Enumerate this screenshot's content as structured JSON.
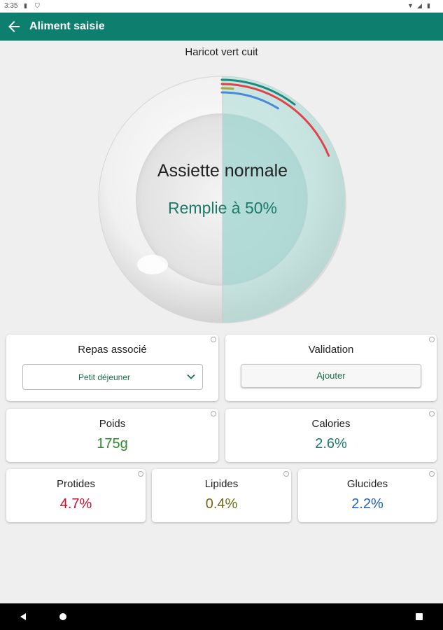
{
  "status_bar": {
    "time": "3:35",
    "icons": [
      "sim-icon",
      "shield-icon",
      "wifi-icon",
      "signal-icon",
      "battery-icon"
    ]
  },
  "app_bar": {
    "title": "Aliment saisie",
    "back_icon": "arrow-left-icon"
  },
  "food": {
    "name": "Haricot vert cuit"
  },
  "plate": {
    "title": "Assiette normale",
    "fill_text": "Remplie à 50%",
    "fill_fraction": 0.5,
    "rings": [
      {
        "name": "calories",
        "color": "#1a8a7a",
        "fraction": 0.026
      },
      {
        "name": "protides",
        "color": "#e0434a",
        "fraction": 0.047
      },
      {
        "name": "lipides",
        "color": "#a8a930",
        "fraction": 0.004
      },
      {
        "name": "glucides",
        "color": "#4a89d9",
        "fraction": 0.022
      }
    ]
  },
  "meal": {
    "label": "Repas associé",
    "selected": "Petit déjeuner"
  },
  "validation": {
    "label": "Validation",
    "button": "Ajouter"
  },
  "weight": {
    "label": "Poids",
    "value": "175g"
  },
  "calories": {
    "label": "Calories",
    "value": "2.6%"
  },
  "protides": {
    "label": "Protides",
    "value": "4.7%"
  },
  "lipides": {
    "label": "Lipides",
    "value": "0.4%"
  },
  "glucides": {
    "label": "Glucides",
    "value": "2.2%"
  },
  "colors": {
    "primary": "#0e7f6e",
    "weight": "#2d8a2d",
    "calories": "#1b7a6a",
    "protides": "#c8102e",
    "lipides": "#6e6a1a",
    "glucides": "#2260b8"
  }
}
